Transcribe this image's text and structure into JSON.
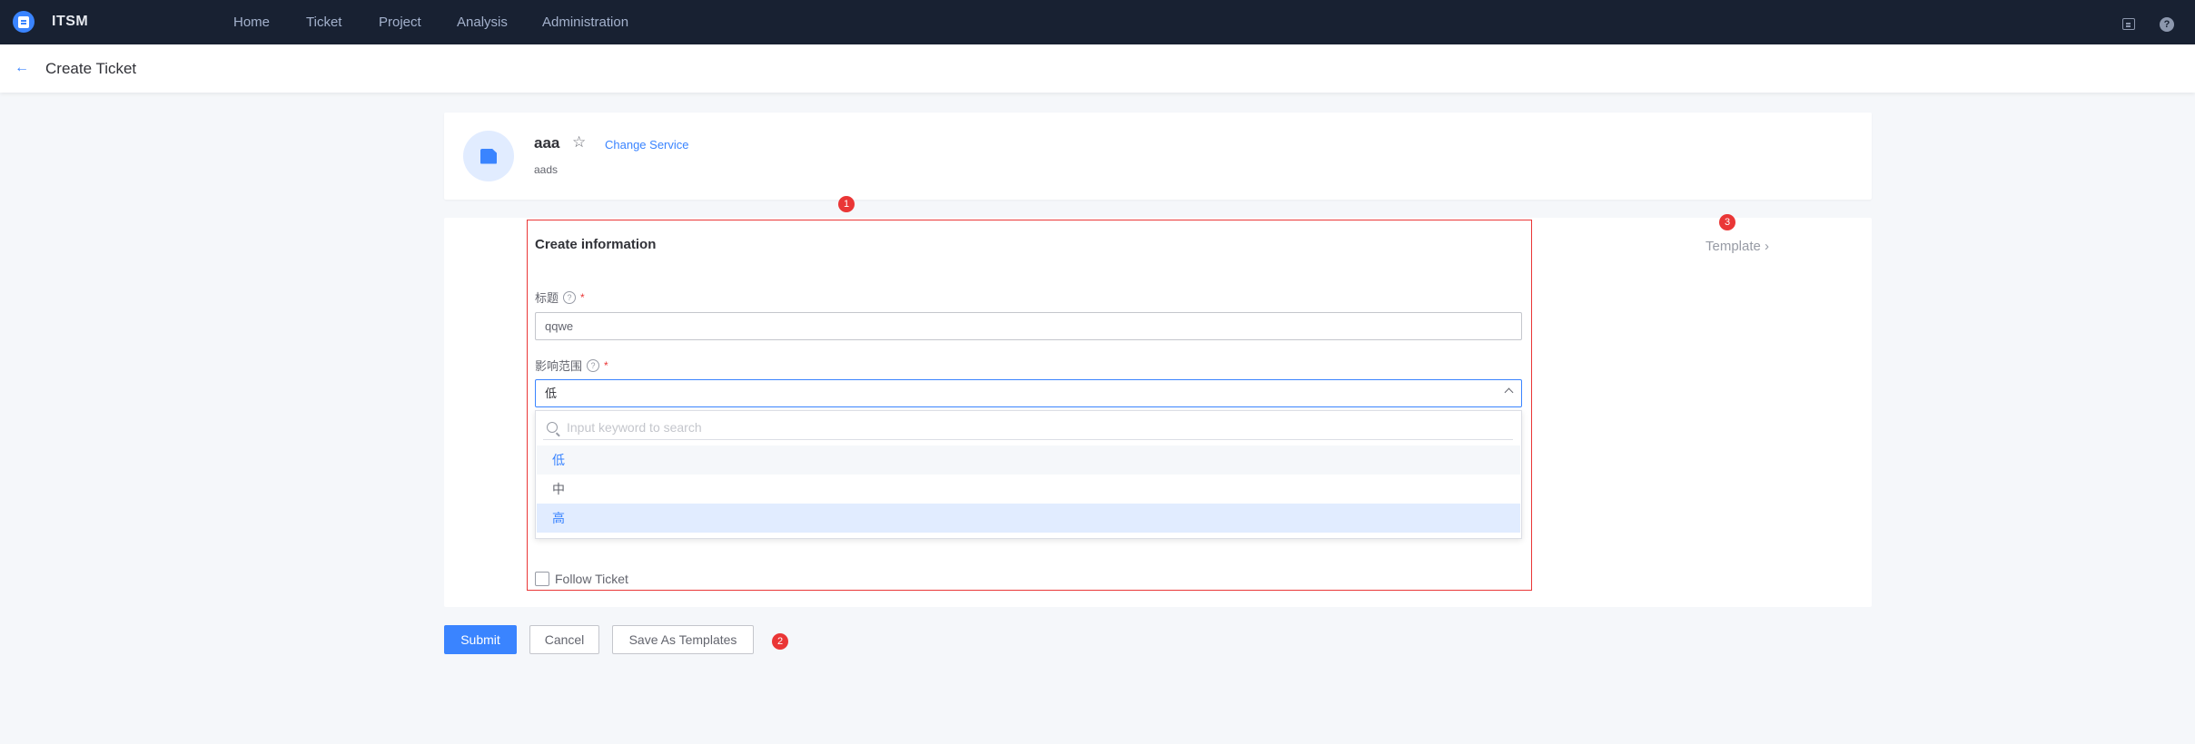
{
  "app": {
    "title": "ITSM"
  },
  "nav": {
    "items": [
      {
        "label": "Home"
      },
      {
        "label": "Ticket"
      },
      {
        "label": "Project"
      },
      {
        "label": "Analysis"
      },
      {
        "label": "Administration"
      }
    ]
  },
  "header": {
    "title": "Create Ticket"
  },
  "service": {
    "name": "aaa",
    "change_label": "Change Service",
    "description": "aads"
  },
  "form": {
    "section_title": "Create information",
    "template_label": "Template  ›",
    "title_field": {
      "label": "标题",
      "required_mark": "*",
      "value": "qqwe"
    },
    "scope_field": {
      "label": "影响范围",
      "required_mark": "*",
      "value": "低",
      "search_placeholder": "Input keyword to search",
      "options": [
        {
          "label": "低"
        },
        {
          "label": "中"
        },
        {
          "label": "高"
        }
      ]
    },
    "follow_label": "Follow Ticket"
  },
  "actions": {
    "submit_label": "Submit",
    "cancel_label": "Cancel",
    "save_template_label": "Save As Templates"
  },
  "annotations": {
    "badge_1": "1",
    "badge_2": "2",
    "badge_3": "3"
  },
  "colors": {
    "accent": "#3a84ff",
    "nav_bg": "#182132",
    "highlight": "#ea3636"
  }
}
